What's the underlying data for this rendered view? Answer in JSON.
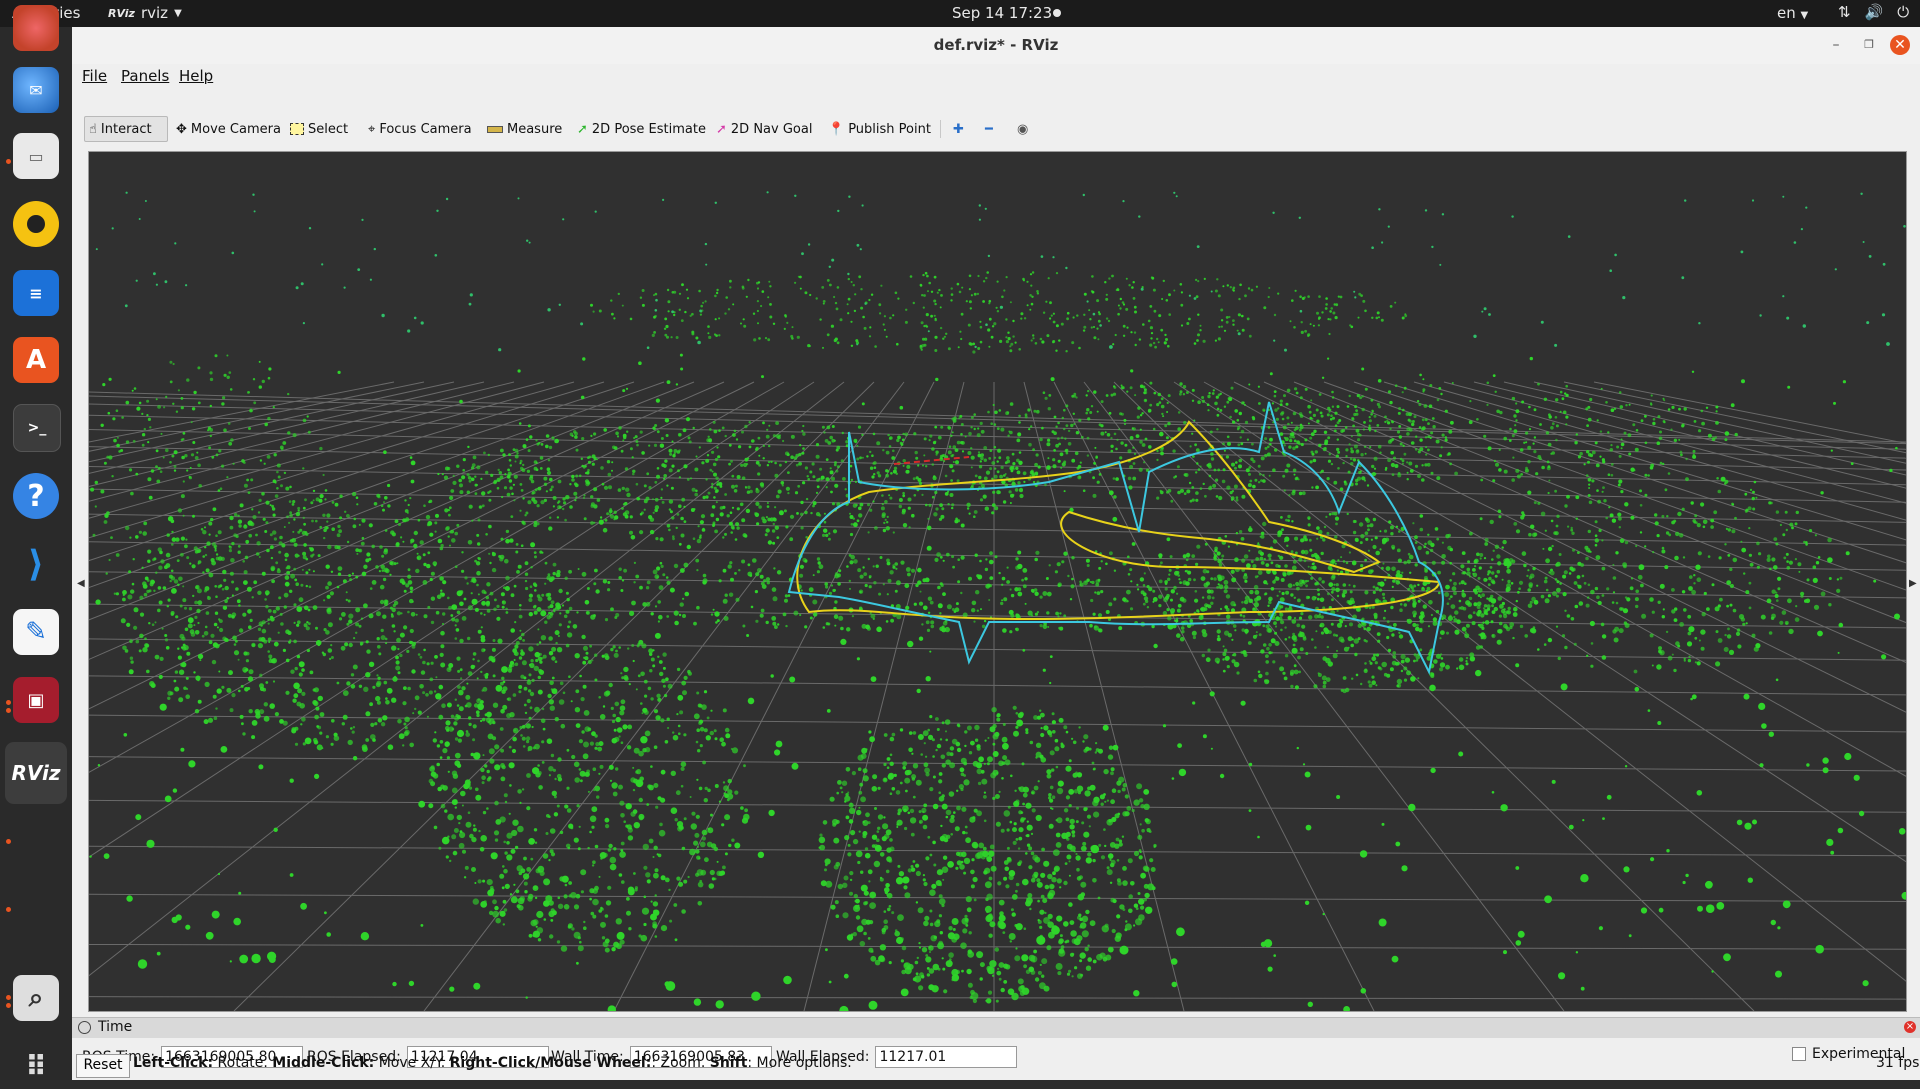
{
  "topbar": {
    "activities": "Activities",
    "app_logo": "RViz",
    "app_name": "rviz",
    "datetime": "Sep 14  17:23",
    "language": "en"
  },
  "dock": {
    "icons": [
      "thunderbird-icon",
      "files-icon",
      "rhythmbox-icon",
      "writer-icon",
      "software-icon",
      "terminal-icon",
      "help-icon",
      "vscode-icon",
      "text-editor-icon",
      "screen-recorder-icon",
      "rviz-icon",
      "search-icon",
      "app-grid-icon"
    ]
  },
  "window": {
    "title": "def.rviz* - RViz",
    "menu": {
      "file": "File",
      "panels": "Panels",
      "help": "Help"
    },
    "toolbar": {
      "interact": "Interact",
      "move_camera": "Move Camera",
      "select": "Select",
      "focus_camera": "Focus Camera",
      "measure": "Measure",
      "pose_estimate": "2D Pose Estimate",
      "nav_goal": "2D Nav Goal",
      "publish_point": "Publish Point"
    }
  },
  "time_panel": {
    "title": "Time",
    "ros_time_label": "ROS Time:",
    "ros_time": "1663169005.80",
    "ros_elapsed_label": "ROS Elapsed:",
    "ros_elapsed": "11217.04",
    "wall_time_label": "Wall Time:",
    "wall_time": "1663169005.83",
    "wall_elapsed_label": "Wall Elapsed:",
    "wall_elapsed": "11217.01",
    "experimental": "Experimental"
  },
  "status": {
    "reset": "Reset",
    "left_click": "Left-Click:",
    "left_click_action": " Rotate. ",
    "middle_click": "Middle-Click:",
    "middle_click_action": " Move X/Y. ",
    "right_click": "Right-Click/Mouse Wheel:",
    "right_click_action": ": Zoom. ",
    "shift": "Shift",
    "shift_action": ": More options.",
    "fps": "31 fps"
  },
  "colors": {
    "points": "#2fd42a",
    "trajectory_yellow": "#e8d21a",
    "trajectory_cyan": "#3cc8e0",
    "grid": "#6a6a6a",
    "accent": "#e95420"
  }
}
